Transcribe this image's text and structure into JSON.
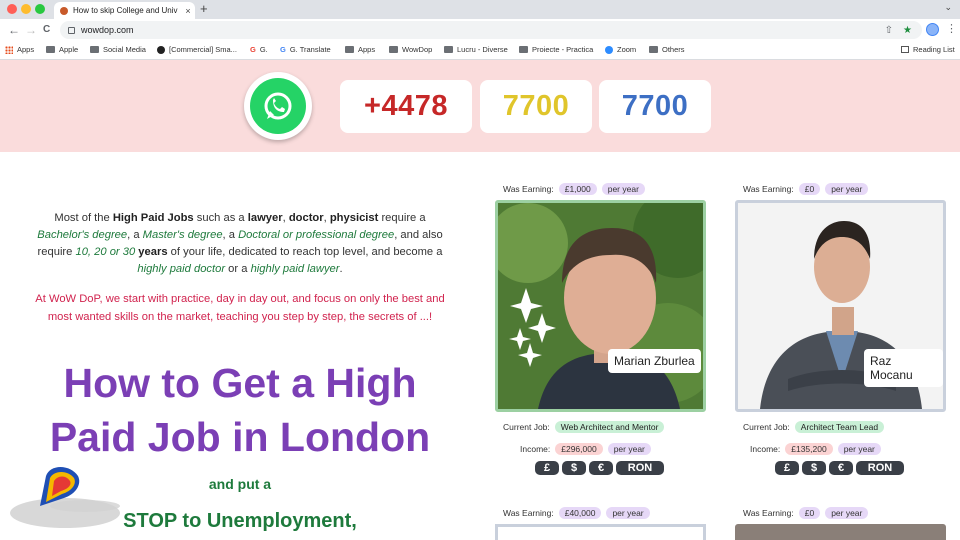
{
  "browser": {
    "tab_title": "How to skip College and Univ",
    "tab_close": "×",
    "new_tab": "+",
    "url": "wowdop.com",
    "back": "←",
    "forward": "→",
    "reload": "C",
    "bookmarks": [
      {
        "label": "Apps",
        "icon": "apps-grid-icon"
      },
      {
        "label": "Apple",
        "icon": "folder-icon"
      },
      {
        "label": "Social Media",
        "icon": "folder-icon"
      },
      {
        "label": "[Commercial] Sma...",
        "icon": "github-icon"
      },
      {
        "label": "G.",
        "icon": "google-icon"
      },
      {
        "label": "G. Translate",
        "icon": "translate-icon"
      },
      {
        "label": "Apps",
        "icon": "folder-icon"
      },
      {
        "label": "WowDop",
        "icon": "folder-icon"
      },
      {
        "label": "Lucru - Diverse",
        "icon": "folder-icon"
      },
      {
        "label": "Proiecte - Practica",
        "icon": "folder-icon"
      },
      {
        "label": "Zoom",
        "icon": "zoom-icon"
      },
      {
        "label": "Others",
        "icon": "folder-icon"
      }
    ],
    "reading_list": "Reading List"
  },
  "hero": {
    "phone_parts": [
      "+4478",
      "7700",
      "7700"
    ],
    "colors": {
      "background": "#fadcdc",
      "part1": "#c62828",
      "part2": "#e0c52b",
      "part3": "#3d6fc4"
    }
  },
  "intro": {
    "t1": "Most of the ",
    "b1": "High Paid Jobs",
    "t2": " such as a ",
    "b2": "lawyer",
    "t3": ", ",
    "b3": "doctor",
    "t4": ", ",
    "b4": "physicist",
    "t5": " require a ",
    "i1": "Bachelor's degree",
    "t6": ", a ",
    "i2": "Master's degree",
    "t7": ", a ",
    "i3": "Doctoral or professional degree",
    "t8": ", and also require ",
    "i4": "10, 20 or 30",
    "b5": " years",
    "t9": " of your life, dedicated to reach top level, and become a ",
    "i5": "highly paid doctor",
    "t10": " or a ",
    "i6": "highly paid lawyer",
    "t11": "."
  },
  "red_text": "At WoW DoP, we start with practice, day in day out, and focus on only the best and most wanted skills on the market, teaching you step by step, the secrets of ...!",
  "headline": "How to Get a High Paid Job in London",
  "sub1": "and put a",
  "sub2": "STOP to Unemployment,",
  "labels": {
    "was_earning": "Was Earning:",
    "per_year": "per year",
    "current_job": "Current Job:",
    "income": "Income:"
  },
  "currencies": [
    "£",
    "$",
    "€",
    "RON"
  ],
  "profiles": [
    {
      "name": "Marian Zburlea",
      "was_earning": "£1,000",
      "current_job": "Web Architect and Mentor",
      "income": "£296,000"
    },
    {
      "name": "Raz Mocanu",
      "was_earning": "£0",
      "current_job": "Architect Team Lead",
      "income": "£135,200"
    },
    {
      "was_earning": "£40,000"
    },
    {
      "was_earning": "£0"
    }
  ]
}
